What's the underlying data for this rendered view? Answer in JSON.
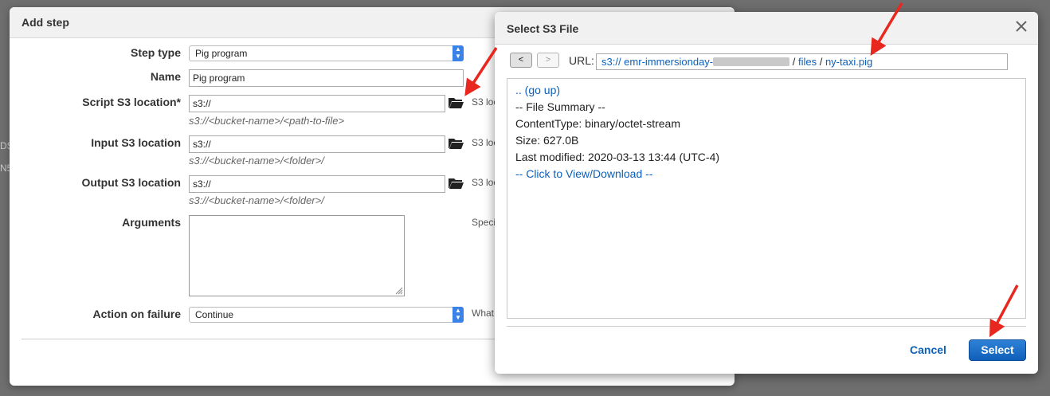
{
  "add_step": {
    "title": "Add step",
    "step_type": {
      "label": "Step type",
      "value": "Pig program"
    },
    "name": {
      "label": "Name",
      "value": "Pig program"
    },
    "script": {
      "label": "Script S3 location*",
      "value": "s3://",
      "hint": "s3://<bucket-name>/<path-to-file>",
      "side": "S3 loc"
    },
    "input": {
      "label": "Input S3 location",
      "value": "s3://",
      "hint": "s3://<bucket-name>/<folder>/",
      "side": "S3 loc"
    },
    "output": {
      "label": "Output S3 location",
      "value": "s3://",
      "hint": "s3://<bucket-name>/<folder>/",
      "side": "S3 loc"
    },
    "arguments": {
      "label": "Arguments",
      "side": "Speci"
    },
    "action": {
      "label": "Action on failure",
      "value": "Continue",
      "side": "What"
    }
  },
  "s3_dialog": {
    "title": "Select S3 File",
    "back_label": "<",
    "forward_label": ">",
    "url_label": "URL:",
    "url": {
      "prefix": "s3:// emr-immersionday-",
      "sep1": " / ",
      "folder": "files",
      "sep2": " / ",
      "file": "ny-taxi.pig"
    },
    "listing": {
      "go_up": ".. (go up)",
      "summary": "-- File Summary --",
      "content_type": "ContentType: binary/octet-stream",
      "size": "Size: 627.0B",
      "modified": "Last modified: 2020-03-13 13:44 (UTC-4)",
      "view": "-- Click to View/Download --"
    },
    "cancel_label": "Cancel",
    "select_label": "Select"
  },
  "colors": {
    "link": "#0c60b8",
    "primary_button": "#1565c0",
    "annotation_arrow": "#e8281e"
  }
}
